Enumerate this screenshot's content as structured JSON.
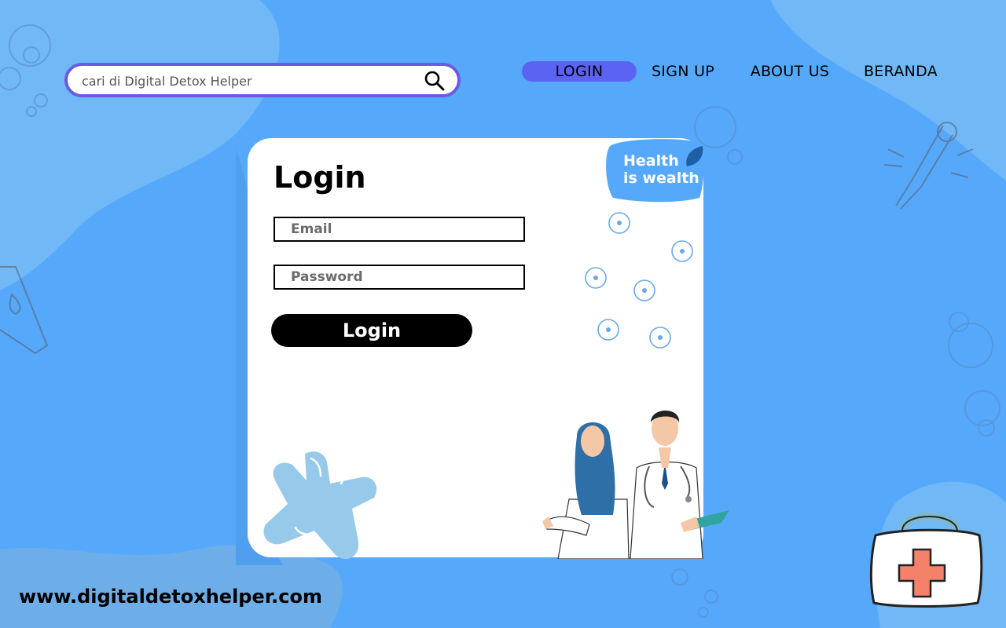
{
  "search": {
    "placeholder": "cari di Digital Detox Helper",
    "icon": "search-icon"
  },
  "nav": {
    "items": [
      {
        "label": "LOGIN",
        "active": true
      },
      {
        "label": "SIGN UP",
        "active": false
      },
      {
        "label": "ABOUT US",
        "active": false
      },
      {
        "label": "BERANDA",
        "active": false
      }
    ]
  },
  "login_card": {
    "title": "Login",
    "email_placeholder": "Email",
    "password_placeholder": "Password",
    "submit_label": "Login"
  },
  "badge": {
    "line1": "Health",
    "line2": "is wealth"
  },
  "footer": {
    "url": "www.digitaldetoxhelper.com"
  },
  "colors": {
    "background": "#56a9fa",
    "accent": "#5b64f2",
    "search_border": "#6a5be0",
    "button": "#000000",
    "card": "#ffffff"
  }
}
